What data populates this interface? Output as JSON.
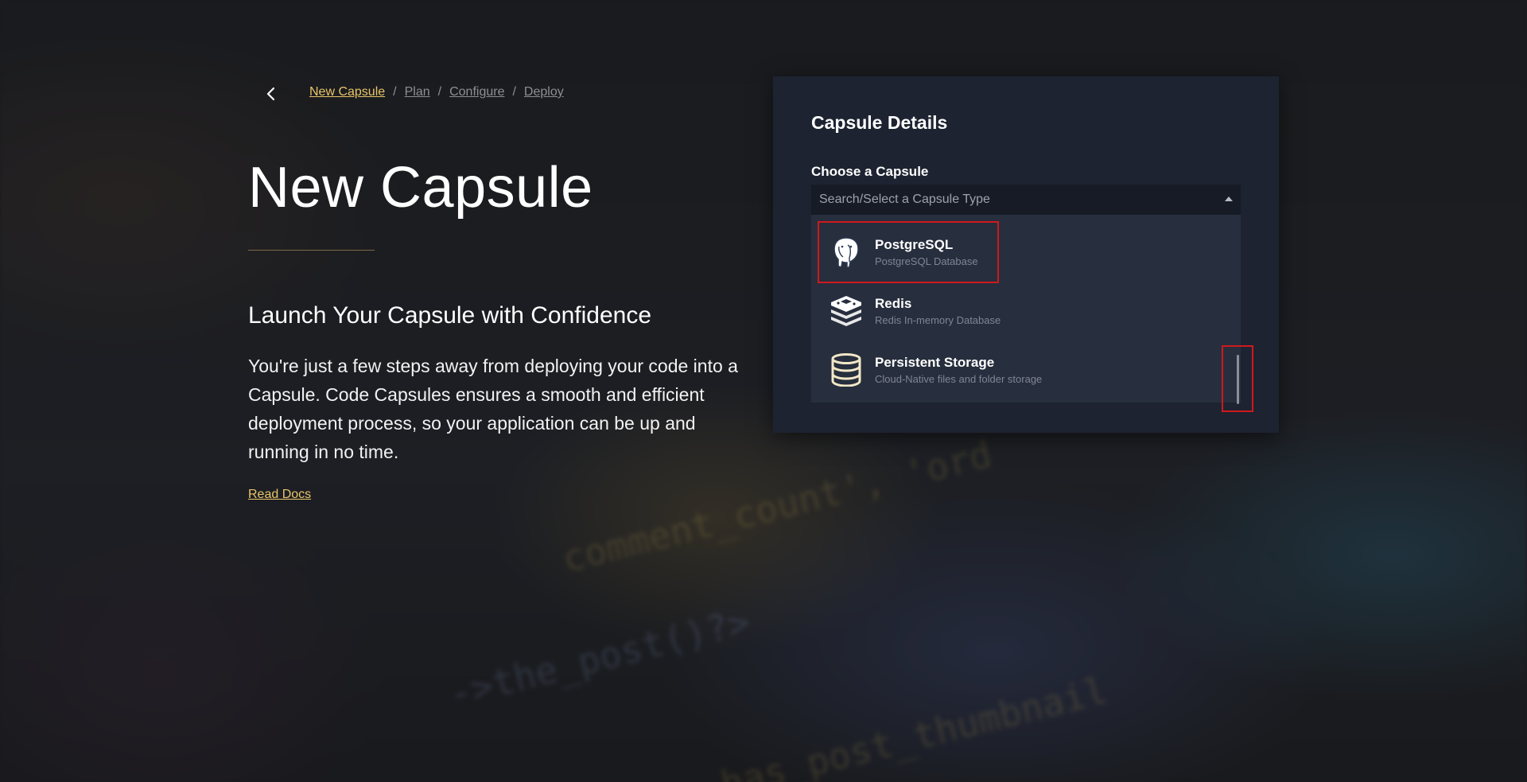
{
  "breadcrumb": {
    "back_icon": "chevron-left-icon",
    "items": [
      {
        "label": "New Capsule",
        "active": true
      },
      {
        "label": "Plan",
        "active": false
      },
      {
        "label": "Configure",
        "active": false
      },
      {
        "label": "Deploy",
        "active": false
      }
    ],
    "separator": "/"
  },
  "hero": {
    "title": "New Capsule",
    "subtitle": "Launch Your Capsule with Confidence",
    "description": "You're just a few steps away from deploying your code into a Capsule. Code Capsules ensures a smooth and efficient deployment process, so your application can be up and running in no time.",
    "read_docs": "Read Docs"
  },
  "card": {
    "title": "Capsule Details",
    "field_label": "Choose a Capsule",
    "select": {
      "placeholder": "Search/Select a Capsule Type",
      "value": "",
      "expanded": true
    },
    "options": [
      {
        "name": "PostgreSQL",
        "description": "PostgreSQL Database",
        "icon": "postgresql-elephant-icon"
      },
      {
        "name": "Redis",
        "description": "Redis In-memory Database",
        "icon": "redis-icon"
      },
      {
        "name": "Persistent Storage",
        "description": "Cloud-Native files and folder storage",
        "icon": "database-storage-icon"
      }
    ]
  },
  "background_code": [
    "comment_count', 'ord",
    "->the_post()?>",
    "has_post_thumbnail"
  ],
  "colors": {
    "accent": "#e9c46a",
    "card_bg": "#1d2331",
    "dropdown_bg": "#272e3d",
    "highlight": "#d0191d"
  }
}
